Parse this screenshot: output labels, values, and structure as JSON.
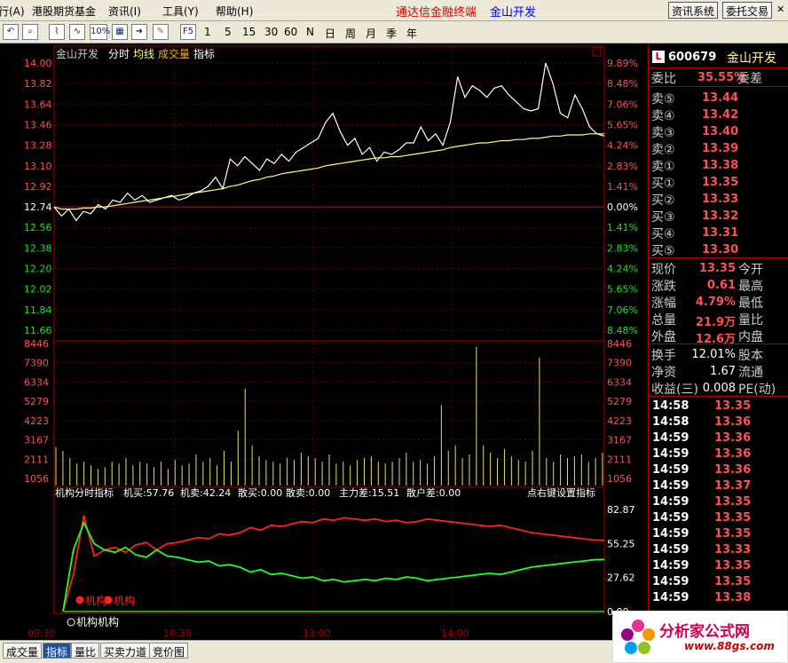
{
  "menubar": {
    "items": [
      "行(A)",
      "港股期货基金",
      "资讯(I)",
      "工具(Y)",
      "帮助(H)"
    ],
    "title_main": "通达信金融终端",
    "title_stock": "金山开发",
    "info_btn": "资讯系统",
    "trade_btn": "委托交易"
  },
  "toolbar": {
    "zoom": "10%",
    "f5": "F5",
    "periods": [
      "1",
      "5",
      "15",
      "30",
      "60",
      "N",
      "日",
      "周",
      "月",
      "季",
      "年"
    ]
  },
  "chart_data": [
    {
      "type": "line",
      "title": "金山开发",
      "legend": [
        "分时",
        "均线",
        "成交量",
        "指标"
      ],
      "y_left_ticks": [
        "14.00",
        "13.82",
        "13.64",
        "13.46",
        "13.28",
        "13.10",
        "12.92",
        "12.74",
        "12.56",
        "12.38",
        "12.20",
        "12.02",
        "11.84",
        "11.66"
      ],
      "y_right_ticks": [
        "9.89%",
        "8.48%",
        "7.06%",
        "5.65%",
        "4.24%",
        "2.83%",
        "1.41%",
        "0.00%",
        "1.41%",
        "2.83%",
        "4.24%",
        "5.65%",
        "7.06%",
        "8.48%"
      ],
      "x_ticks": [
        "09:30",
        "10:30",
        "13:00",
        "14:00"
      ],
      "ylim": [
        11.58,
        14.0
      ],
      "prev_close": 12.74,
      "series": [
        {
          "name": "分时",
          "color": "#ffffff",
          "values": [
            12.74,
            12.66,
            12.72,
            12.62,
            12.7,
            12.68,
            12.76,
            12.72,
            12.8,
            12.78,
            12.86,
            12.8,
            12.84,
            12.78,
            12.8,
            12.82,
            12.84,
            12.8,
            12.82,
            12.86,
            12.88,
            12.92,
            13.0,
            12.9,
            13.16,
            13.1,
            13.18,
            13.12,
            13.06,
            13.16,
            13.12,
            13.2,
            13.14,
            13.22,
            13.26,
            13.3,
            13.34,
            13.48,
            13.56,
            13.4,
            13.28,
            13.34,
            13.2,
            13.26,
            13.14,
            13.22,
            13.2,
            13.24,
            13.3,
            13.3,
            13.44,
            13.32,
            13.38,
            13.28,
            13.48,
            13.88,
            13.7,
            13.8,
            13.76,
            13.7,
            13.78,
            13.8,
            13.72,
            13.66,
            13.6,
            13.58,
            13.6,
            14.0,
            13.82,
            13.56,
            13.52,
            13.72,
            13.6,
            13.44,
            13.38,
            13.36
          ]
        },
        {
          "name": "均线",
          "color": "#ffff80",
          "values": [
            12.74,
            12.72,
            12.72,
            12.72,
            12.73,
            12.73,
            12.74,
            12.74,
            12.75,
            12.76,
            12.77,
            12.78,
            12.79,
            12.8,
            12.81,
            12.82,
            12.83,
            12.84,
            12.85,
            12.86,
            12.87,
            12.88,
            12.89,
            12.9,
            12.92,
            12.93,
            12.95,
            12.97,
            12.98,
            13.0,
            13.01,
            13.03,
            13.04,
            13.05,
            13.06,
            13.07,
            13.08,
            13.1,
            13.11,
            13.12,
            13.13,
            13.14,
            13.15,
            13.16,
            13.17,
            13.17,
            13.18,
            13.18,
            13.19,
            13.2,
            13.21,
            13.22,
            13.23,
            13.24,
            13.26,
            13.27,
            13.28,
            13.29,
            13.3,
            13.3,
            13.31,
            13.32,
            13.32,
            13.33,
            13.33,
            13.34,
            13.34,
            13.35,
            13.36,
            13.36,
            13.37,
            13.37,
            13.37,
            13.38,
            13.38,
            13.38
          ]
        }
      ]
    },
    {
      "type": "bar",
      "title": "成交量",
      "y_ticks": [
        "8446",
        "7390",
        "6334",
        "5279",
        "4223",
        "3167",
        "2111",
        "1056"
      ],
      "ylim": [
        0,
        8446
      ],
      "values": [
        2100,
        1900,
        1500,
        1200,
        1300,
        1100,
        900,
        1000,
        1300,
        1200,
        1500,
        1100,
        1300,
        1200,
        1000,
        1300,
        900,
        1400,
        1100,
        1200,
        1700,
        1300,
        1500,
        1100,
        1900,
        1300,
        3000,
        5300,
        2200,
        1600,
        1400,
        1300,
        1200,
        1500,
        1400,
        1800,
        1600,
        1500,
        1300,
        1700,
        1200,
        1300,
        1100,
        1400,
        1500,
        1600,
        1300,
        1200,
        1300,
        1500,
        1800,
        1300,
        1400,
        1200,
        1600,
        4400,
        1900,
        2200,
        1500,
        1700,
        7600,
        2200,
        1800,
        1500,
        2000,
        1600,
        1400,
        1300,
        1900,
        7000,
        1500,
        1300,
        1700,
        1500,
        1600,
        1700,
        1300,
        1500,
        1800
      ]
    },
    {
      "type": "line",
      "title": "机构分时指标",
      "y_ticks": [
        "82.87",
        "55.25",
        "27.62",
        "0.00"
      ],
      "ylim": [
        0,
        90
      ],
      "series": [
        {
          "name": "机买",
          "color": "#ff2020",
          "values": [
            0,
            30,
            78,
            45,
            50,
            52,
            48,
            54,
            56,
            50,
            55,
            56,
            58,
            60,
            59,
            63,
            62,
            64,
            68,
            66,
            70,
            69,
            71,
            73,
            72,
            75,
            74,
            76,
            75,
            74,
            75,
            73,
            74,
            72,
            73,
            75,
            74,
            73,
            72,
            71,
            70,
            69,
            70,
            68,
            66,
            64,
            63,
            62,
            61,
            60,
            59,
            58,
            57.76
          ]
        },
        {
          "name": "机卖",
          "color": "#20ff20",
          "values": [
            0,
            50,
            72,
            55,
            50,
            48,
            52,
            46,
            44,
            50,
            45,
            44,
            42,
            40,
            41,
            37,
            38,
            36,
            32,
            34,
            30,
            31,
            29,
            27,
            28,
            25,
            26,
            24,
            25,
            26,
            25,
            27,
            26,
            28,
            27,
            25,
            26,
            27,
            28,
            29,
            30,
            31,
            30,
            32,
            34,
            36,
            37,
            38,
            39,
            40,
            41,
            42,
            42.24
          ]
        }
      ]
    }
  ],
  "indicator": {
    "title": "机构分时指标",
    "jimai": "机买:57.76",
    "jimai2": "机卖:42.24",
    "sanmai": "散买:0.00",
    "sanmai2": "散卖:0.00",
    "zhulichai": "主力差:15.51",
    "sanhuchai": "散户差:0.00",
    "setting": "点右键设置指标",
    "legend1": "机构",
    "legend2": "机构",
    "legend3": "机构机构"
  },
  "panel": {
    "code": "600679",
    "name": "金山开发",
    "weibi_label": "委比",
    "weibi_val": "35.55%",
    "weicha_label": "委差",
    "sell": [
      [
        "卖⑤",
        "13.44"
      ],
      [
        "卖④",
        "13.42"
      ],
      [
        "卖③",
        "13.40"
      ],
      [
        "卖②",
        "13.39"
      ],
      [
        "卖①",
        "13.38"
      ]
    ],
    "buy": [
      [
        "买①",
        "13.35"
      ],
      [
        "买②",
        "13.33"
      ],
      [
        "买③",
        "13.32"
      ],
      [
        "买④",
        "13.31"
      ],
      [
        "买⑤",
        "13.30"
      ]
    ],
    "stats": [
      [
        "现价",
        "13.35",
        "今开"
      ],
      [
        "涨跌",
        "0.61",
        "最高"
      ],
      [
        "涨幅",
        "4.79%",
        "最低"
      ],
      [
        "总量",
        "21.9万",
        "量比"
      ],
      [
        "外盘",
        "12.6万",
        "内盘"
      ]
    ],
    "stats2": [
      [
        "换手",
        "12.01%",
        "股本"
      ],
      [
        "净资",
        "1.67",
        "流通"
      ],
      [
        "收益(三)",
        "0.008",
        "PE(动)"
      ]
    ],
    "ticks": [
      [
        "14:58",
        "13.35"
      ],
      [
        "14:58",
        "13.36"
      ],
      [
        "14:59",
        "13.36"
      ],
      [
        "14:59",
        "13.36"
      ],
      [
        "14:59",
        "13.36"
      ],
      [
        "14:59",
        "13.37"
      ],
      [
        "14:59",
        "13.35"
      ],
      [
        "14:59",
        "13.35"
      ],
      [
        "14:59",
        "13.35"
      ],
      [
        "14:59",
        "13.33"
      ],
      [
        "14:59",
        "13.35"
      ],
      [
        "14:59",
        "13.35"
      ],
      [
        "14:59",
        "13.38"
      ]
    ]
  },
  "bottom_tabs": [
    "成交量",
    "指标",
    "量比",
    "买卖力道",
    "竞价图"
  ],
  "logo": {
    "text": "分析家公式网",
    "url": "www.88gs.com"
  }
}
